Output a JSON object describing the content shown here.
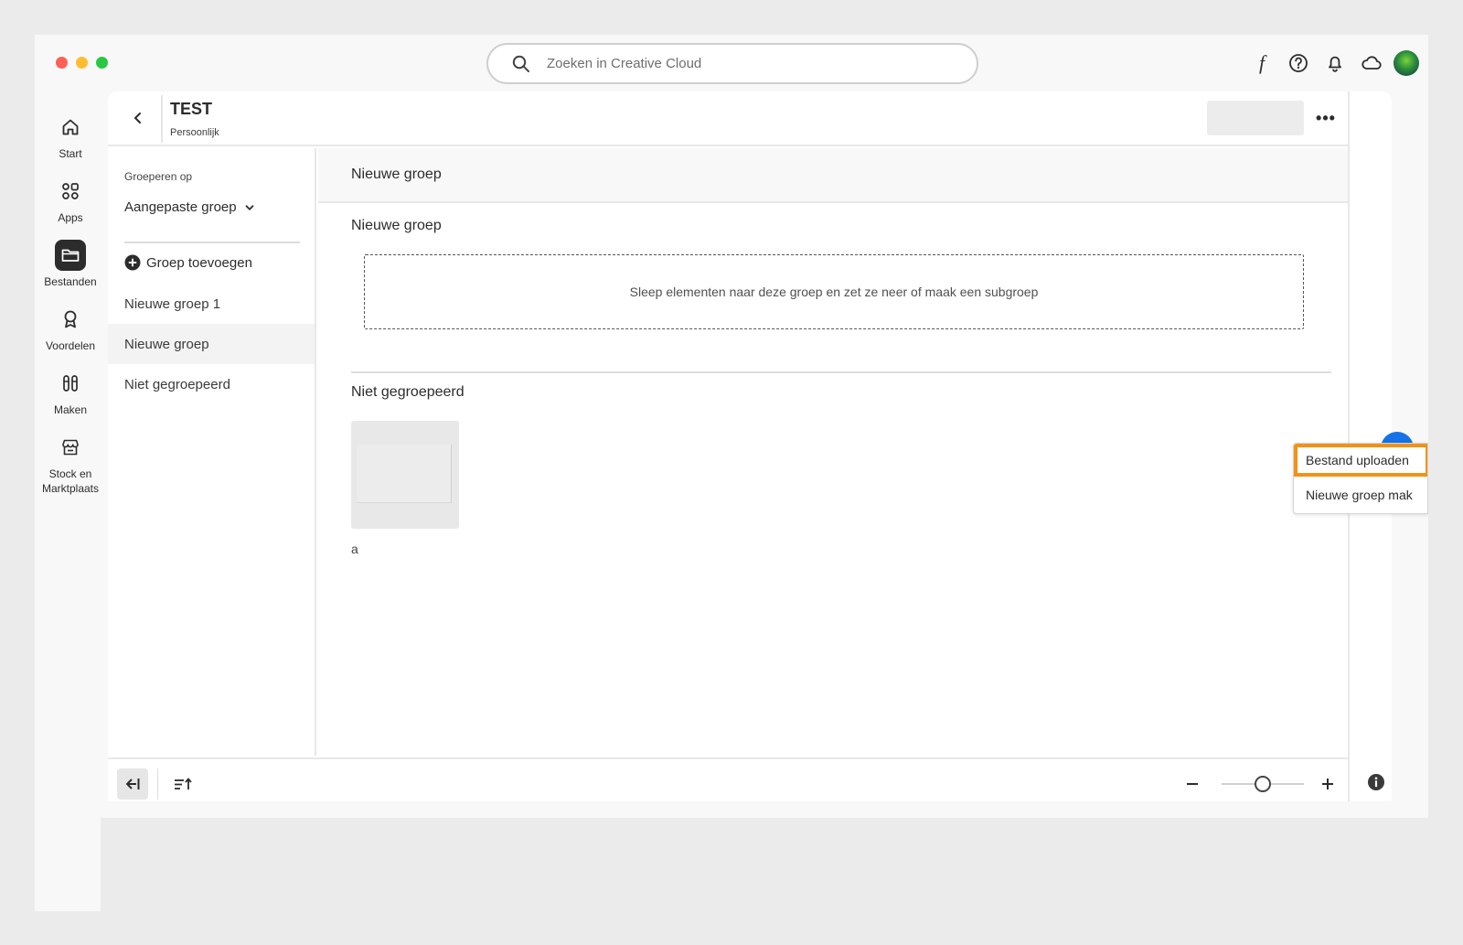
{
  "search": {
    "placeholder": "Zoeken in Creative Cloud"
  },
  "topbar": {
    "icons": [
      "font-icon",
      "help-icon",
      "bell-icon",
      "cloud-icon",
      "avatar"
    ]
  },
  "nav": {
    "items": [
      {
        "label": "Start",
        "icon": "home-icon"
      },
      {
        "label": "Apps",
        "icon": "apps-icon"
      },
      {
        "label": "Bestanden",
        "icon": "folder-icon",
        "active": true
      },
      {
        "label": "Voordelen",
        "icon": "award-icon"
      },
      {
        "label": "Maken",
        "icon": "brushes-icon"
      },
      {
        "label": "Stock en Marktplaats",
        "icon": "store-icon"
      }
    ]
  },
  "project": {
    "title": "TEST",
    "subtitle": "Persoonlijk"
  },
  "groups": {
    "group_by_label": "Groeperen op",
    "selected_grouping": "Aangepaste groep",
    "add_label": "Groep toevoegen",
    "items": [
      "Nieuwe groep 1",
      "Nieuwe groep",
      "Niet gegroepeerd"
    ],
    "selected_index": 1
  },
  "content": {
    "topbar_title": "Nieuwe groep",
    "section1_title": "Nieuwe groep",
    "dropzone_text": "Sleep elementen naar deze groep en zet ze neer of maak een subgroep",
    "section2_title": "Niet gegroepeerd",
    "file_name": "a"
  },
  "menu": {
    "items": [
      "Bestand uploaden",
      "Nieuwe groep mak"
    ]
  },
  "colors": {
    "accent": "#1473e6",
    "highlight": "#f39116"
  }
}
